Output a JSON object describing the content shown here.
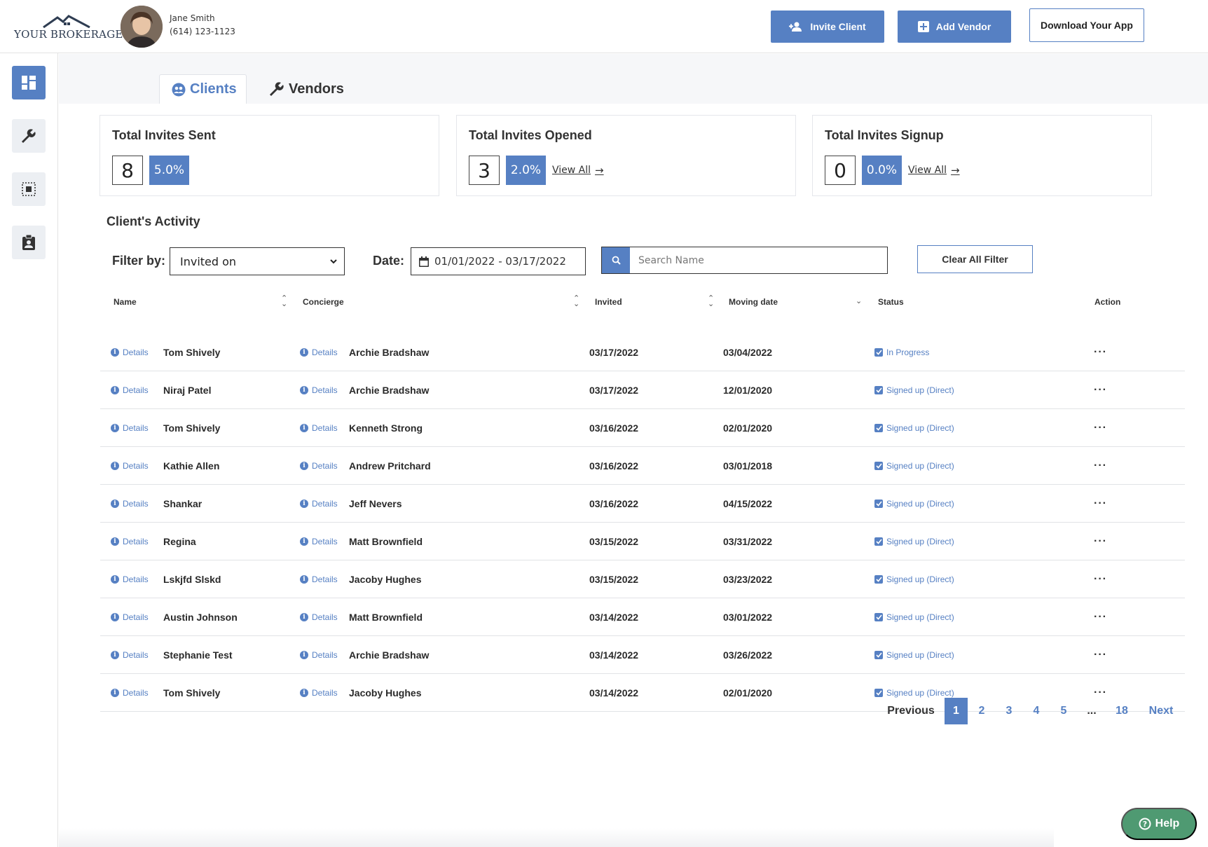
{
  "header": {
    "logo_text": "YOUR BROKERAGE",
    "agent_name": "Jane Smith",
    "agent_phone": "(614) 123-1123",
    "invite_client_label": "Invite Client",
    "add_vendor_label": "Add Vendor",
    "download_app_label": "Download Your App"
  },
  "tabs": [
    {
      "label": "Clients",
      "active": true
    },
    {
      "label": "Vendors",
      "active": false
    }
  ],
  "stats": [
    {
      "title": "Total Invites Sent",
      "count": "8",
      "percent": "5.0%",
      "link": ""
    },
    {
      "title": "Total Invites Opened",
      "count": "3",
      "percent": "2.0%",
      "link": "View All"
    },
    {
      "title": "Total Invites Signup",
      "count": "0",
      "percent": "0.0%",
      "link": "View All"
    }
  ],
  "activity": {
    "title": "Client's Activity",
    "filter_label": "Filter by:",
    "filter_value": "Invited on",
    "date_label": "Date:",
    "date_range": "01/01/2022 - 03/17/2022",
    "search_placeholder": "Search Name",
    "clear_label": "Clear All Filter"
  },
  "table": {
    "columns": [
      "Name",
      "Concierge",
      "Invited",
      "Moving date",
      "Status",
      "Action"
    ],
    "details_label": "Details",
    "action_label": "···",
    "rows": [
      {
        "name": "Tom Shively",
        "concierge": "Archie Bradshaw",
        "invited": "03/17/2022",
        "moving": "03/04/2022",
        "status": "In Progress"
      },
      {
        "name": "Niraj Patel",
        "concierge": "Archie Bradshaw",
        "invited": "03/17/2022",
        "moving": "12/01/2020",
        "status": "Signed up (Direct)"
      },
      {
        "name": "Tom Shively",
        "concierge": "Kenneth Strong",
        "invited": "03/16/2022",
        "moving": "02/01/2020",
        "status": "Signed up (Direct)"
      },
      {
        "name": "Kathie Allen",
        "concierge": "Andrew Pritchard",
        "invited": "03/16/2022",
        "moving": "03/01/2018",
        "status": "Signed up (Direct)"
      },
      {
        "name": "Shankar",
        "concierge": "Jeff Nevers",
        "invited": "03/16/2022",
        "moving": "04/15/2022",
        "status": "Signed up (Direct)"
      },
      {
        "name": "Regina",
        "concierge": "Matt Brownfield",
        "invited": "03/15/2022",
        "moving": "03/31/2022",
        "status": "Signed up (Direct)"
      },
      {
        "name": "Lskjfd Slskd",
        "concierge": "Jacoby Hughes",
        "invited": "03/15/2022",
        "moving": "03/23/2022",
        "status": "Signed up (Direct)"
      },
      {
        "name": "Austin Johnson",
        "concierge": "Matt Brownfield",
        "invited": "03/14/2022",
        "moving": "03/01/2022",
        "status": "Signed up (Direct)"
      },
      {
        "name": "Stephanie Test",
        "concierge": "Archie Bradshaw",
        "invited": "03/14/2022",
        "moving": "03/26/2022",
        "status": "Signed up (Direct)"
      },
      {
        "name": "Tom Shively",
        "concierge": "Jacoby Hughes",
        "invited": "03/14/2022",
        "moving": "02/01/2020",
        "status": "Signed up (Direct)"
      }
    ]
  },
  "pagination": {
    "previous": "Previous",
    "pages": [
      "1",
      "2",
      "3",
      "4",
      "5",
      "...",
      "18"
    ],
    "current": "1",
    "next": "Next"
  },
  "help_label": "Help",
  "colors": {
    "accent": "#5680c3",
    "help": "#4f9a72"
  }
}
